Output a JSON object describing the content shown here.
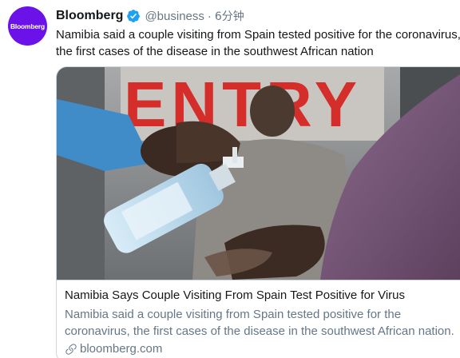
{
  "account": {
    "display_name": "Bloomberg",
    "handle": "@business",
    "separator": "·",
    "time": "6分钟",
    "avatar_text": "Bloomberg",
    "avatar_color": "#6b12e8",
    "verified_color": "#1da1f2"
  },
  "tweet": {
    "lines": [
      "Namibia said a couple visiting from Spain tested positive for the coronavirus,",
      "the first cases of the disease in the southwest African nation"
    ]
  },
  "card": {
    "image_sign_text": "ENTRY",
    "title": "Namibia Says Couple Visiting From Spain Test Positive for Virus",
    "description_lines": [
      "Namibia said a couple visiting from Spain tested positive for the",
      "coronavirus, the first cases of the disease in the southwest African nation."
    ],
    "domain": "bloomberg.com",
    "link_icon": "link-icon"
  }
}
